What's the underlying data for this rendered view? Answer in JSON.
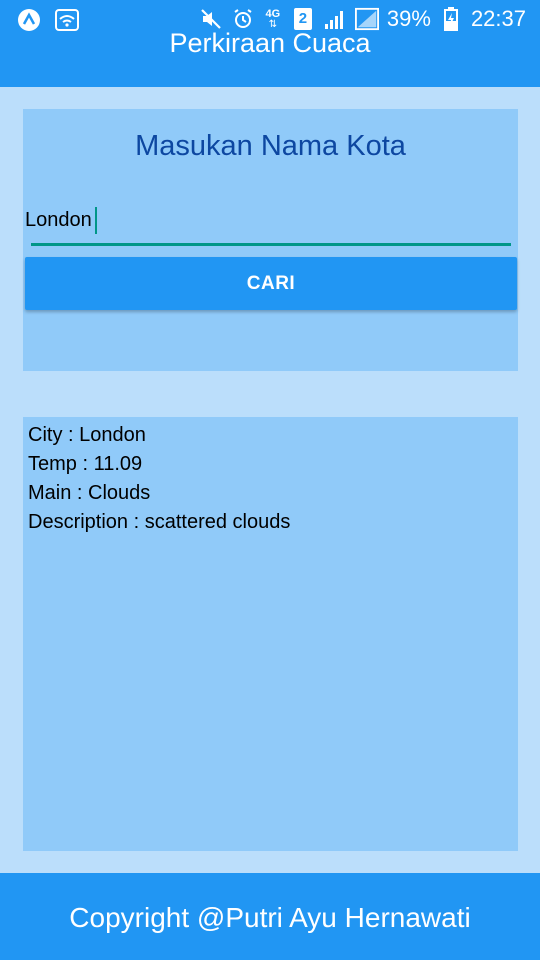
{
  "status_bar": {
    "battery_percent": "39%",
    "time": "22:37",
    "network_label": "4G",
    "sim_number": "2",
    "icons": [
      "app-a-icon",
      "wifi-icon",
      "mute-icon",
      "alarm-icon",
      "4g-icon",
      "sim-2-icon",
      "signal-icon",
      "signal-empty-icon",
      "battery-charging-icon"
    ]
  },
  "app_bar": {
    "title": "Perkiraan Cuaca"
  },
  "search": {
    "heading": "Masukan Nama Kota",
    "input_value": "London",
    "button_label": "CARI"
  },
  "result": {
    "lines": [
      "City : London",
      "Temp : 11.09",
      "Main : Clouds",
      "Description : scattered clouds"
    ]
  },
  "footer": {
    "text": "Copyright @Putri Ayu Hernawati"
  },
  "colors": {
    "primary": "#2196f3",
    "background": "#bbdefb",
    "card": "#90caf9",
    "heading": "#0d47a1",
    "accent": "#009688"
  }
}
